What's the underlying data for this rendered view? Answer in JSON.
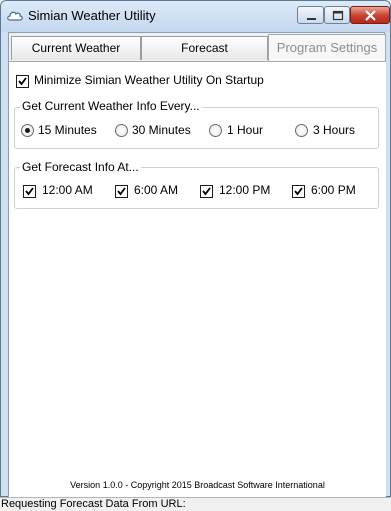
{
  "window": {
    "title": "Simian Weather Utility",
    "icon": "cloud-icon"
  },
  "tabs": [
    {
      "label": "Current Weather",
      "active": false
    },
    {
      "label": "Forecast",
      "active": false
    },
    {
      "label": "Program Settings",
      "active": true
    }
  ],
  "settings": {
    "minimize_label": "Minimize Simian Weather Utility On Startup",
    "minimize_checked": true,
    "current_group": {
      "title": "Get Current Weather Info Every...",
      "options": [
        {
          "label": "15 Minutes",
          "selected": true
        },
        {
          "label": "30 Minutes",
          "selected": false
        },
        {
          "label": "1 Hour",
          "selected": false
        },
        {
          "label": "3 Hours",
          "selected": false
        }
      ]
    },
    "forecast_group": {
      "title": "Get Forecast Info At...",
      "options": [
        {
          "label": "12:00 AM",
          "checked": true
        },
        {
          "label": "6:00 AM",
          "checked": true
        },
        {
          "label": "12:00 PM",
          "checked": true
        },
        {
          "label": "6:00 PM",
          "checked": true
        }
      ]
    }
  },
  "version_text": "Version 1.0.0 - Copyright 2015 Broadcast Software International",
  "status_text": "Requesting Forecast Data From URL:",
  "colors": {
    "titlebar": "#c3d7ee",
    "close_button": "#c8412f",
    "panel": "#ffffff",
    "frame": "#cfe0f2"
  }
}
